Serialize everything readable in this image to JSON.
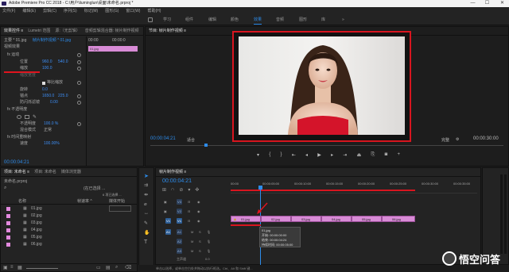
{
  "titlebar": {
    "text": "Adobe Premiere Pro CC 2018 - C:\\用户\\liuminglun\\桌面\\未命名.prproj *",
    "min": "—",
    "max": "☐",
    "close": "✕"
  },
  "menu": [
    "文件(F)",
    "编辑(E)",
    "剪辑(C)",
    "序列(S)",
    "标记(M)",
    "图形(G)",
    "窗口(W)",
    "帮助(H)"
  ],
  "workspaces": [
    "学习",
    "组件",
    "编辑",
    "颜色",
    "效果",
    "音频",
    "图形",
    "库"
  ],
  "workspace_more": "»",
  "effect_controls": {
    "tabs": [
      "效果控件 ≡",
      "Lumetri 范围",
      "源:（无剪辑）",
      "音频剪辑混合器: 帧片制作视频"
    ],
    "source_row": "主要 * 01.jpg",
    "clip_row": "帧片制作视频 * 01.jpg",
    "header_time": "00:00",
    "right_time": "00:00:0",
    "right_clip": "01.jpg",
    "section_video": "视频效果",
    "fx_motion": "fx 运动",
    "rows": [
      {
        "label": "位置",
        "v1": "960.0",
        "v2": "540.0"
      },
      {
        "label": "缩放",
        "v1": "100.0",
        "v2": ""
      },
      {
        "label": "缩放宽度",
        "v1": "",
        "v2": ""
      },
      {
        "label": "",
        "v1": "",
        "v2": ""
      },
      {
        "label": "旋转",
        "v1": "0.0",
        "v2": ""
      },
      {
        "label": "锚点",
        "v1": "1650.0",
        "v2": "225.0"
      },
      {
        "label": "防闪烁滤镜",
        "v1": "0.00",
        "v2": ""
      }
    ],
    "uniform_scale": "等比缩放",
    "fx_opacity": "fx 不透明度",
    "opacity_label": "不透明度",
    "opacity_value": "100.0 %",
    "blend_label": "混合模式",
    "blend_value": "正常",
    "fx_timeremap": "fx 时间重映射",
    "speed_label": "速度",
    "speed_value": "100.00%",
    "footer_time": "00:00:04:21"
  },
  "program_monitor": {
    "tab": "节目: 帧片制作视频 ≡",
    "timecode": "00:00:04:21",
    "fit": "适合",
    "quality": "完整",
    "duration": "00:00:30:00"
  },
  "project": {
    "tabs": [
      "项目: 未命名 ≡",
      "项目: 未命名",
      "媒体浏览器"
    ],
    "file": "未命名.prproj",
    "search_hint": "(在已选择 ...",
    "count": "6 项已选择 ...",
    "columns": [
      "名称",
      "帧速率 ^",
      "媒体开始"
    ],
    "items": [
      "01.jpg",
      "02.jpg",
      "03.jpg",
      "04.jpg",
      "05.jpg",
      "06.jpg"
    ],
    "footer_hint": "单击以选择，或单击空白处并拖动以执行框选。Ctrl、Alt 和 Shift 键..."
  },
  "timeline": {
    "tab": "帧片制作视频 ≡",
    "timecode": "00:00:04:21",
    "ruler": [
      "00:00",
      "00:00:05:00",
      "00:00:10:00",
      "00:00:15:00",
      "00:00:20:00",
      "00:00:25:00",
      "00:00:30:00",
      "00:00:35:00"
    ],
    "video_tracks": [
      "V3",
      "V2",
      "V1"
    ],
    "audio_tracks": [
      "A1",
      "A2",
      "A3"
    ],
    "master": "主声道",
    "master_val": "0.0",
    "clips": [
      "01.jpg",
      "02.jpg",
      "03.jpg",
      "04.jpg",
      "05.jpg",
      "06.jpg"
    ],
    "tooltip": {
      "name": "01.jpg",
      "start": "开始: 00:00:00:00",
      "end": "结束: 00:00:04:24",
      "duration": "持续时间: 00:00:05:00"
    }
  },
  "watermark": "悟空问答",
  "colors": {
    "accent": "#2d8ceb",
    "clip": "#d88bd6",
    "red_annotation": "#e0141e"
  }
}
